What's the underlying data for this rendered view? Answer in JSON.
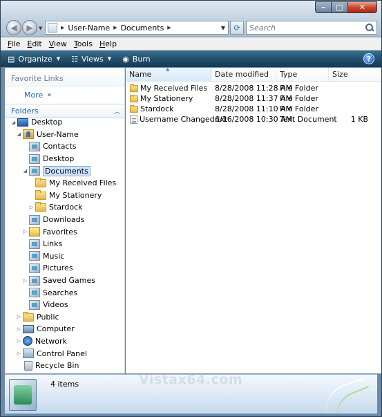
{
  "address": {
    "crumbs": [
      "User-Name",
      "Documents"
    ]
  },
  "search": {
    "placeholder": "Search"
  },
  "menu": {
    "items": [
      {
        "u": "F",
        "rest": "ile"
      },
      {
        "u": "E",
        "rest": "dit"
      },
      {
        "u": "V",
        "rest": "iew"
      },
      {
        "u": "T",
        "rest": "ools"
      },
      {
        "u": "H",
        "rest": "elp"
      }
    ]
  },
  "toolbar": {
    "organize": "Organize",
    "views": "Views",
    "burn": "Burn"
  },
  "nav": {
    "favorite_links": "Favorite Links",
    "more": "More",
    "folders": "Folders",
    "tree": [
      {
        "label": "Desktop",
        "icon": "desktop-icon"
      },
      {
        "label": "User-Name",
        "icon": "user-folder-icon"
      },
      {
        "label": "Contacts",
        "icon": "contacts-icon"
      },
      {
        "label": "Desktop",
        "icon": "desktop-folder-icon"
      },
      {
        "label": "Documents",
        "icon": "documents-icon"
      },
      {
        "label": "My Received Files",
        "icon": "folder-icon"
      },
      {
        "label": "My Stationery",
        "icon": "folder-icon"
      },
      {
        "label": "Stardock",
        "icon": "folder-icon"
      },
      {
        "label": "Downloads",
        "icon": "downloads-icon"
      },
      {
        "label": "Favorites",
        "icon": "favorites-icon"
      },
      {
        "label": "Links",
        "icon": "links-icon"
      },
      {
        "label": "Music",
        "icon": "music-icon"
      },
      {
        "label": "Pictures",
        "icon": "pictures-icon"
      },
      {
        "label": "Saved Games",
        "icon": "saved-games-icon"
      },
      {
        "label": "Searches",
        "icon": "searches-icon"
      },
      {
        "label": "Videos",
        "icon": "videos-icon"
      },
      {
        "label": "Public",
        "icon": "folder-icon"
      },
      {
        "label": "Computer",
        "icon": "computer-icon"
      },
      {
        "label": "Network",
        "icon": "network-icon"
      },
      {
        "label": "Control Panel",
        "icon": "control-panel-icon"
      },
      {
        "label": "Recycle Bin",
        "icon": "recycle-bin-icon"
      }
    ]
  },
  "files": {
    "columns": [
      "Name",
      "Date modified",
      "Type",
      "Size"
    ],
    "rows": [
      {
        "name": "My Received Files",
        "date": "8/28/2008 11:28 AM",
        "type": "File Folder",
        "size": ""
      },
      {
        "name": "My Stationery",
        "date": "8/28/2008 11:37 AM",
        "type": "File Folder",
        "size": ""
      },
      {
        "name": "Stardock",
        "date": "8/28/2008 11:10 AM",
        "type": "File Folder",
        "size": ""
      },
      {
        "name": "Username Changed.txt",
        "date": "6/16/2008 10:30 AM",
        "type": "Text Document",
        "size": "1 KB"
      }
    ]
  },
  "details": {
    "item_count": "4 items",
    "watermark": "Vistax64.com"
  }
}
